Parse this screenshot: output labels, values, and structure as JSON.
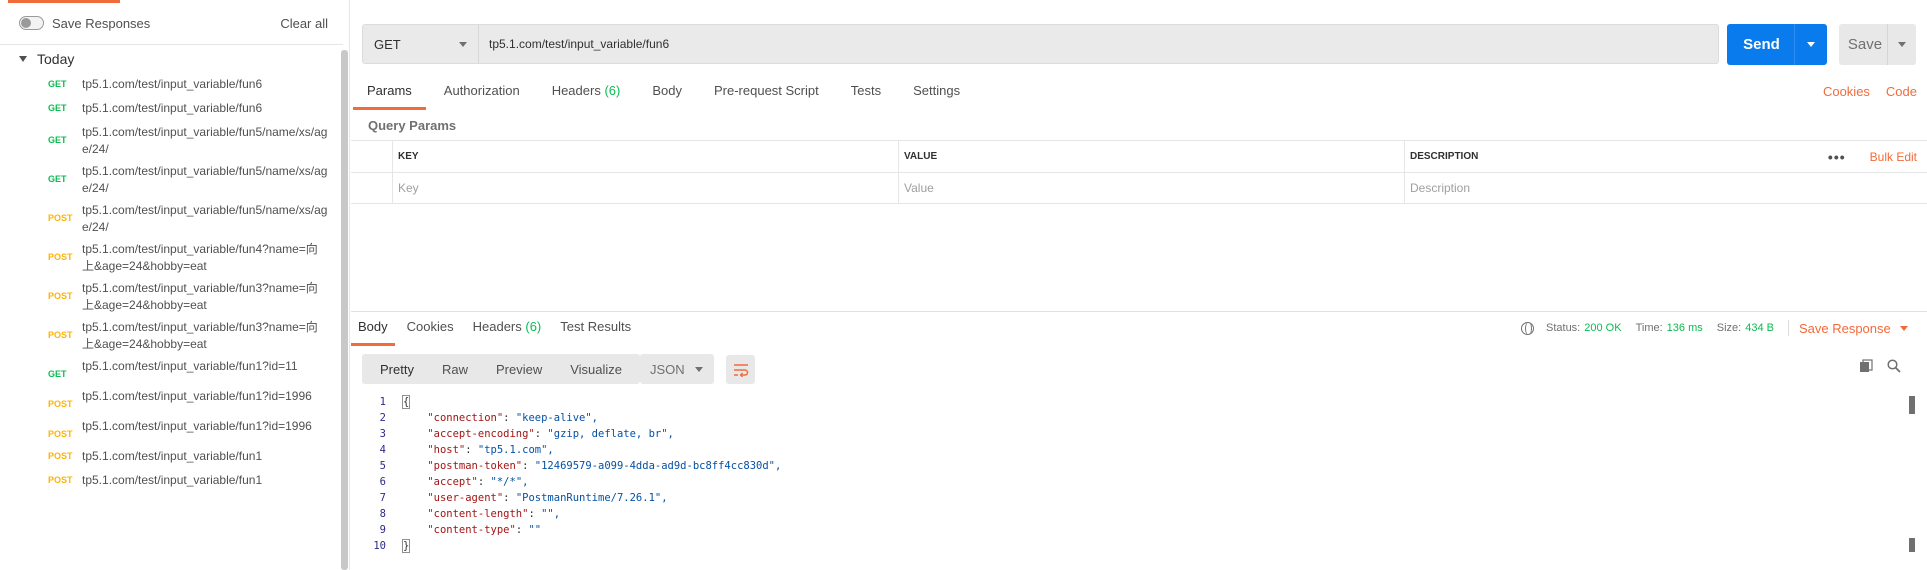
{
  "sidebar": {
    "save_responses_label": "Save Responses",
    "clear_all_label": "Clear all",
    "group_label": "Today",
    "history": [
      {
        "method": "GET",
        "url": "tp5.1.com/test/input_variable/fun6"
      },
      {
        "method": "GET",
        "url": "tp5.1.com/test/input_variable/fun6"
      },
      {
        "method": "GET",
        "url": "tp5.1.com/test/input_variable/fun5/name/xs/age/24/"
      },
      {
        "method": "GET",
        "url": "tp5.1.com/test/input_variable/fun5/name/xs/age/24/"
      },
      {
        "method": "POST",
        "url": "tp5.1.com/test/input_variable/fun5/name/xs/age/24/"
      },
      {
        "method": "POST",
        "url": "tp5.1.com/test/input_variable/fun4?name=向上&age=24&hobby=eat"
      },
      {
        "method": "POST",
        "url": "tp5.1.com/test/input_variable/fun3?name=向上&age=24&hobby=eat"
      },
      {
        "method": "POST",
        "url": "tp5.1.com/test/input_variable/fun3?name=向上&age=24&hobby=eat"
      },
      {
        "method": "GET",
        "url": "tp5.1.com/test/input_variable/fun1?id=11"
      },
      {
        "method": "POST",
        "url": "tp5.1.com/test/input_variable/fun1?id=1996"
      },
      {
        "method": "POST",
        "url": "tp5.1.com/test/input_variable/fun1?id=1996"
      },
      {
        "method": "POST",
        "url": "tp5.1.com/test/input_variable/fun1"
      },
      {
        "method": "POST",
        "url": "tp5.1.com/test/input_variable/fun1"
      }
    ]
  },
  "request": {
    "method": "GET",
    "url": "tp5.1.com/test/input_variable/fun6",
    "send_label": "Send",
    "save_label": "Save"
  },
  "request_tabs": {
    "params": "Params",
    "authorization": "Authorization",
    "headers": "Headers",
    "headers_count": "(6)",
    "body": "Body",
    "pre_request": "Pre-request Script",
    "tests": "Tests",
    "settings": "Settings"
  },
  "links": {
    "cookies": "Cookies",
    "code": "Code"
  },
  "query_params": {
    "title": "Query Params",
    "columns": {
      "key": "KEY",
      "value": "VALUE",
      "description": "DESCRIPTION"
    },
    "bulk_edit": "Bulk Edit",
    "placeholders": {
      "key": "Key",
      "value": "Value",
      "description": "Description"
    }
  },
  "response_tabs": {
    "body": "Body",
    "cookies": "Cookies",
    "headers": "Headers",
    "headers_count": "(6)",
    "test_results": "Test Results"
  },
  "response_meta": {
    "status_label": "Status:",
    "status_value": "200 OK",
    "time_label": "Time:",
    "time_value": "136 ms",
    "size_label": "Size:",
    "size_value": "434 B",
    "save_response": "Save Response"
  },
  "response_view": {
    "modes": [
      "Pretty",
      "Raw",
      "Preview",
      "Visualize"
    ],
    "format": "JSON"
  },
  "response_body": [
    {
      "n": "1",
      "open": "{"
    },
    {
      "n": "2",
      "key": "\"connection\"",
      "val": "\"keep-alive\","
    },
    {
      "n": "3",
      "key": "\"accept-encoding\"",
      "val": "\"gzip, deflate, br\","
    },
    {
      "n": "4",
      "key": "\"host\"",
      "val": "\"tp5.1.com\","
    },
    {
      "n": "5",
      "key": "\"postman-token\"",
      "val": "\"12469579-a099-4dda-ad9d-bc8ff4cc830d\","
    },
    {
      "n": "6",
      "key": "\"accept\"",
      "val": "\"*/*\","
    },
    {
      "n": "7",
      "key": "\"user-agent\"",
      "val": "\"PostmanRuntime/7.26.1\","
    },
    {
      "n": "8",
      "key": "\"content-length\"",
      "val": "\"\","
    },
    {
      "n": "9",
      "key": "\"content-type\"",
      "val": "\"\""
    },
    {
      "n": "10",
      "open": "}"
    }
  ],
  "colors": {
    "accent": "#f26b3a",
    "send": "#097bed",
    "get": "#0cbb52",
    "post": "#ffb400",
    "success": "#0cbb52"
  }
}
